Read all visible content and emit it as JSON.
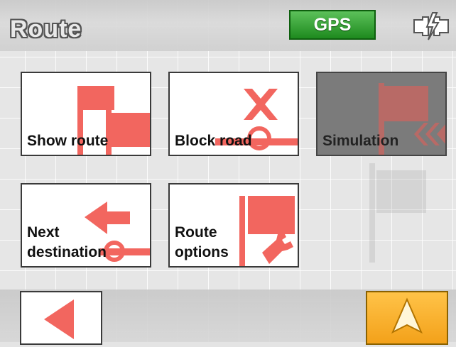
{
  "header": {
    "title": "Route",
    "gps_label": "GPS"
  },
  "tiles": [
    {
      "label": "Show route",
      "icon": "flags-icon",
      "enabled": true
    },
    {
      "label": "Block road",
      "icon": "road-block-icon",
      "enabled": true
    },
    {
      "label": "Simulation",
      "icon": "simulation-flag-icon",
      "enabled": false
    },
    {
      "label_line1": "Next",
      "label_line2": "destination",
      "icon": "arrow-left-icon",
      "enabled": true
    },
    {
      "label_line1": "Route",
      "label_line2": "options",
      "icon": "flag-wrench-icon",
      "enabled": true
    }
  ],
  "footer": {
    "back_icon": "back-triangle-icon",
    "nav_icon": "navigation-arrow-icon"
  },
  "colors": {
    "icon_red": "#f2665f",
    "gps_green": "#3aa83a",
    "nav_orange": "#f7ac2c"
  }
}
